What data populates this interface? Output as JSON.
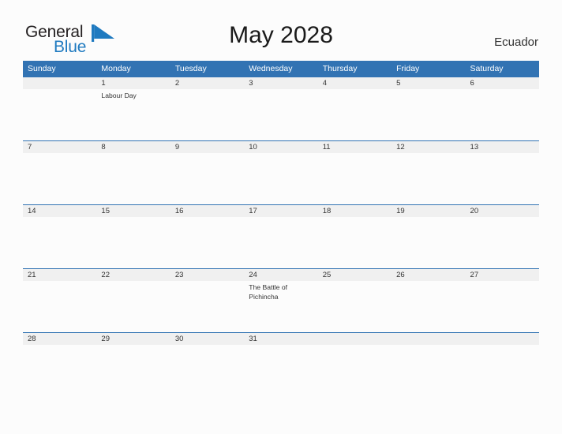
{
  "brand": {
    "name_part1": "General",
    "name_part2": "Blue",
    "flag_icon": "blue-triangle-flag",
    "color_primary": "#1f7ac0",
    "color_dark": "#231f20"
  },
  "header": {
    "title": "May 2028",
    "country": "Ecuador"
  },
  "colors": {
    "header_blue": "#3273b3",
    "date_band_gray": "#f0f0f0",
    "page_background": "#fcfcfc",
    "text": "#333333"
  },
  "calendar": {
    "month": "May",
    "year": "2028",
    "weekday_headers": [
      "Sunday",
      "Monday",
      "Tuesday",
      "Wednesday",
      "Thursday",
      "Friday",
      "Saturday"
    ],
    "weeks": [
      {
        "days": [
          {
            "date": "",
            "event": ""
          },
          {
            "date": "1",
            "event": "Labour Day"
          },
          {
            "date": "2",
            "event": ""
          },
          {
            "date": "3",
            "event": ""
          },
          {
            "date": "4",
            "event": ""
          },
          {
            "date": "5",
            "event": ""
          },
          {
            "date": "6",
            "event": ""
          }
        ]
      },
      {
        "days": [
          {
            "date": "7",
            "event": ""
          },
          {
            "date": "8",
            "event": ""
          },
          {
            "date": "9",
            "event": ""
          },
          {
            "date": "10",
            "event": ""
          },
          {
            "date": "11",
            "event": ""
          },
          {
            "date": "12",
            "event": ""
          },
          {
            "date": "13",
            "event": ""
          }
        ]
      },
      {
        "days": [
          {
            "date": "14",
            "event": ""
          },
          {
            "date": "15",
            "event": ""
          },
          {
            "date": "16",
            "event": ""
          },
          {
            "date": "17",
            "event": ""
          },
          {
            "date": "18",
            "event": ""
          },
          {
            "date": "19",
            "event": ""
          },
          {
            "date": "20",
            "event": ""
          }
        ]
      },
      {
        "days": [
          {
            "date": "21",
            "event": ""
          },
          {
            "date": "22",
            "event": ""
          },
          {
            "date": "23",
            "event": ""
          },
          {
            "date": "24",
            "event": "The Battle of Pichincha"
          },
          {
            "date": "25",
            "event": ""
          },
          {
            "date": "26",
            "event": ""
          },
          {
            "date": "27",
            "event": ""
          }
        ]
      },
      {
        "days": [
          {
            "date": "28",
            "event": ""
          },
          {
            "date": "29",
            "event": ""
          },
          {
            "date": "30",
            "event": ""
          },
          {
            "date": "31",
            "event": ""
          },
          {
            "date": "",
            "event": ""
          },
          {
            "date": "",
            "event": ""
          },
          {
            "date": "",
            "event": ""
          }
        ]
      }
    ]
  }
}
